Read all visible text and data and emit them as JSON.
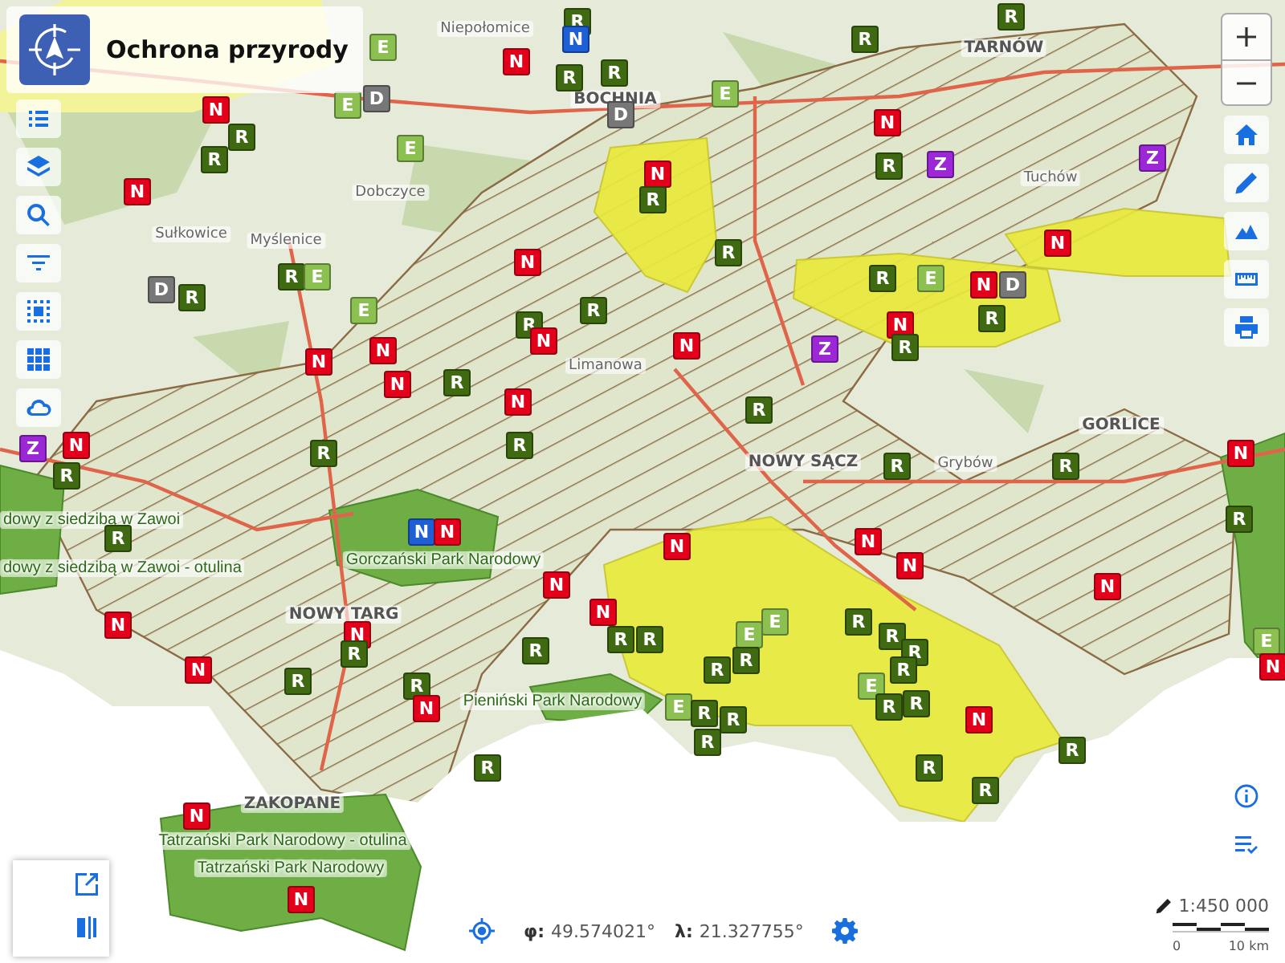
{
  "header": {
    "title": "Ochrona przyrody"
  },
  "map": {
    "place_labels": [
      {
        "text": "Niepołomice",
        "kind": "town"
      },
      {
        "text": "TARNÓW",
        "kind": "city"
      },
      {
        "text": "BOCHNIA",
        "kind": "city"
      },
      {
        "text": "Tuchów",
        "kind": "town"
      },
      {
        "text": "Dobczyce",
        "kind": "town"
      },
      {
        "text": "Sułkowice",
        "kind": "town"
      },
      {
        "text": "Myślenice",
        "kind": "town"
      },
      {
        "text": "Limanowa",
        "kind": "town"
      },
      {
        "text": "NOWY SĄCZ",
        "kind": "city"
      },
      {
        "text": "Grybów",
        "kind": "town"
      },
      {
        "text": "GORLICE",
        "kind": "city"
      },
      {
        "text": "dowy z siedzibą w Zawoi",
        "kind": "park"
      },
      {
        "text": "Gorczański Park Narodowy",
        "kind": "park"
      },
      {
        "text": "dowy z siedzibą w Zawoi - otulina",
        "kind": "park"
      },
      {
        "text": "NOWY TARG",
        "kind": "city"
      },
      {
        "text": "Pieniński Park Narodowy",
        "kind": "park"
      },
      {
        "text": "ZAKOPANE",
        "kind": "city"
      },
      {
        "text": "Tatrzański Park Narodowy - otulina",
        "kind": "park"
      },
      {
        "text": "Tatrzański Park Narodowy",
        "kind": "park"
      }
    ],
    "markers": [
      {
        "label": "R",
        "color": "#3f6a12"
      },
      {
        "label": "N",
        "color": "#1e5fd6"
      },
      {
        "label": "N",
        "color": "#e2001a"
      },
      {
        "label": "R",
        "color": "#3f6a12"
      },
      {
        "label": "R",
        "color": "#3f6a12"
      },
      {
        "label": "E",
        "color": "#8cc152"
      },
      {
        "label": "D",
        "color": "#777777"
      },
      {
        "label": "R",
        "color": "#3f6a12"
      },
      {
        "label": "R",
        "color": "#3f6a12"
      },
      {
        "label": "N",
        "color": "#e2001a"
      },
      {
        "label": "R",
        "color": "#3f6a12"
      },
      {
        "label": "Z",
        "color": "#9b27d6"
      },
      {
        "label": "Z",
        "color": "#9b27d6"
      },
      {
        "label": "N",
        "color": "#e2001a"
      },
      {
        "label": "R",
        "color": "#3f6a12"
      },
      {
        "label": "R",
        "color": "#3f6a12"
      },
      {
        "label": "N",
        "color": "#e2001a"
      },
      {
        "label": "N",
        "color": "#e2001a"
      },
      {
        "label": "R",
        "color": "#3f6a12"
      },
      {
        "label": "E",
        "color": "#8cc152"
      },
      {
        "label": "N",
        "color": "#e2001a"
      },
      {
        "label": "D",
        "color": "#777777"
      },
      {
        "label": "R",
        "color": "#3f6a12"
      },
      {
        "label": "N",
        "color": "#e2001a"
      },
      {
        "label": "Z",
        "color": "#9b27d6"
      },
      {
        "label": "R",
        "color": "#3f6a12"
      },
      {
        "label": "R",
        "color": "#3f6a12"
      },
      {
        "label": "R",
        "color": "#3f6a12"
      },
      {
        "label": "N",
        "color": "#e2001a"
      },
      {
        "label": "N",
        "color": "#e2001a"
      },
      {
        "label": "R",
        "color": "#3f6a12"
      },
      {
        "label": "R",
        "color": "#3f6a12"
      },
      {
        "label": "N",
        "color": "#e2001a"
      },
      {
        "label": "D",
        "color": "#777777"
      },
      {
        "label": "R",
        "color": "#3f6a12"
      },
      {
        "label": "R",
        "color": "#3f6a12"
      },
      {
        "label": "E",
        "color": "#8cc152"
      },
      {
        "label": "E",
        "color": "#8cc152"
      },
      {
        "label": "N",
        "color": "#e2001a"
      },
      {
        "label": "N",
        "color": "#e2001a"
      },
      {
        "label": "N",
        "color": "#e2001a"
      },
      {
        "label": "Z",
        "color": "#9b27d6"
      },
      {
        "label": "N",
        "color": "#e2001a"
      },
      {
        "label": "R",
        "color": "#3f6a12"
      },
      {
        "label": "R",
        "color": "#3f6a12"
      },
      {
        "label": "E",
        "color": "#8cc152"
      },
      {
        "label": "N",
        "color": "#e2001a"
      },
      {
        "label": "E",
        "color": "#8cc152"
      },
      {
        "label": "D",
        "color": "#777777"
      },
      {
        "label": "E",
        "color": "#8cc152"
      },
      {
        "label": "R",
        "color": "#3f6a12"
      },
      {
        "label": "N",
        "color": "#e2001a"
      },
      {
        "label": "R",
        "color": "#3f6a12"
      },
      {
        "label": "R",
        "color": "#3f6a12"
      },
      {
        "label": "R",
        "color": "#3f6a12"
      },
      {
        "label": "R",
        "color": "#3f6a12"
      },
      {
        "label": "N",
        "color": "#e2001a"
      },
      {
        "label": "R",
        "color": "#3f6a12"
      },
      {
        "label": "N",
        "color": "#e2001a"
      },
      {
        "label": "N",
        "color": "#e2001a"
      },
      {
        "label": "N",
        "color": "#e2001a"
      },
      {
        "label": "N",
        "color": "#e2001a"
      },
      {
        "label": "N",
        "color": "#e2001a"
      },
      {
        "label": "N",
        "color": "#e2001a"
      },
      {
        "label": "R",
        "color": "#3f6a12"
      },
      {
        "label": "R",
        "color": "#3f6a12"
      },
      {
        "label": "E",
        "color": "#8cc152"
      },
      {
        "label": "E",
        "color": "#8cc152"
      },
      {
        "label": "R",
        "color": "#3f6a12"
      },
      {
        "label": "R",
        "color": "#3f6a12"
      },
      {
        "label": "R",
        "color": "#3f6a12"
      },
      {
        "label": "R",
        "color": "#3f6a12"
      },
      {
        "label": "R",
        "color": "#3f6a12"
      },
      {
        "label": "R",
        "color": "#3f6a12"
      },
      {
        "label": "E",
        "color": "#8cc152"
      },
      {
        "label": "R",
        "color": "#3f6a12"
      },
      {
        "label": "R",
        "color": "#3f6a12"
      },
      {
        "label": "N",
        "color": "#e2001a"
      },
      {
        "label": "R",
        "color": "#3f6a12"
      },
      {
        "label": "E",
        "color": "#8cc152"
      },
      {
        "label": "R",
        "color": "#3f6a12"
      },
      {
        "label": "R",
        "color": "#3f6a12"
      },
      {
        "label": "R",
        "color": "#3f6a12"
      },
      {
        "label": "R",
        "color": "#3f6a12"
      },
      {
        "label": "R",
        "color": "#3f6a12"
      },
      {
        "label": "R",
        "color": "#3f6a12"
      },
      {
        "label": "E",
        "color": "#8cc152"
      },
      {
        "label": "N",
        "color": "#e2001a"
      },
      {
        "label": "R",
        "color": "#3f6a12"
      },
      {
        "label": "R",
        "color": "#3f6a12"
      },
      {
        "label": "N",
        "color": "#e2001a"
      },
      {
        "label": "N",
        "color": "#e2001a"
      },
      {
        "label": "R",
        "color": "#3f6a12"
      },
      {
        "label": "N",
        "color": "#e2001a"
      },
      {
        "label": "R",
        "color": "#3f6a12"
      },
      {
        "label": "R",
        "color": "#3f6a12"
      },
      {
        "label": "N",
        "color": "#e2001a"
      },
      {
        "label": "N",
        "color": "#1e5fd6"
      },
      {
        "label": "N",
        "color": "#e2001a"
      },
      {
        "label": "N",
        "color": "#e2001a"
      },
      {
        "label": "N",
        "color": "#e2001a"
      }
    ]
  },
  "coordinates": [
    {
      "symbol": "φ:",
      "value": "49.574021°"
    },
    {
      "symbol": "λ:",
      "value": "21.327755°"
    }
  ],
  "scale": {
    "ratio": "1:450 000",
    "bar_labels": [
      "0",
      "10 km"
    ]
  }
}
